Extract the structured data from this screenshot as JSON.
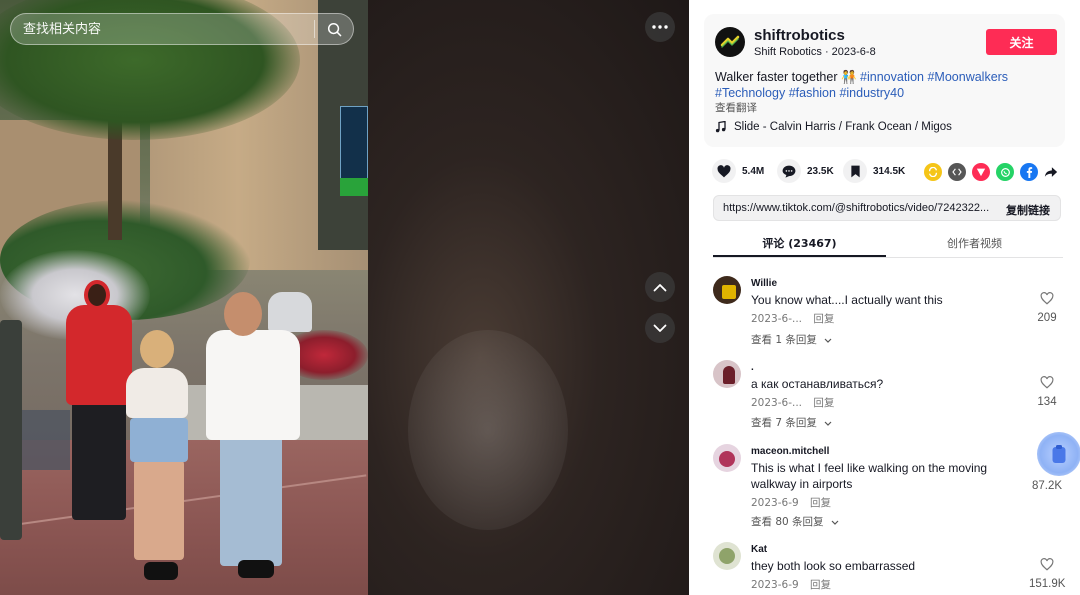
{
  "search": {
    "placeholder": "查找相关内容"
  },
  "video": {
    "more_label": "more",
    "nav_up": "previous",
    "nav_down": "next"
  },
  "author": {
    "name": "shiftrobotics",
    "display": "Shift Robotics",
    "date": "2023-6-8",
    "follow_label": "关注"
  },
  "description": {
    "text": "Walker faster together 🧑‍🤝‍🧑",
    "tags": [
      "#innovation",
      "#Moonwalkers",
      "#Technology",
      "#fashion",
      "#industry40"
    ],
    "translate_label": "查看翻译"
  },
  "music": {
    "title": "Slide - Calvin Harris / Frank Ocean / Migos"
  },
  "stats": {
    "likes": "5.4M",
    "comments": "23.5K",
    "saves": "314.5K"
  },
  "share_icons": [
    "repost-icon",
    "embed-icon",
    "send-icon",
    "whatsapp-icon",
    "facebook-icon",
    "share-arrow-icon"
  ],
  "link": {
    "url": "https://www.tiktok.com/@shiftrobotics/video/7242322...",
    "copy_label": "复制链接"
  },
  "tabs": [
    {
      "label": "评论 (23467)"
    },
    {
      "label": "创作者视频"
    }
  ],
  "comments": [
    {
      "user": "Willie",
      "text": "You know what....I actually want this",
      "date": "2023-6-...",
      "reply": "回复",
      "likes": "209",
      "view_replies": "查看 1 条回复"
    },
    {
      "user": ".",
      "text": "а как останавливаться?",
      "date": "2023-6-...",
      "reply": "回复",
      "likes": "134",
      "view_replies": "查看 7 条回复"
    },
    {
      "user": "maceon.mitchell",
      "text": "This is what I feel like walking on the moving walkway in airports",
      "date": "2023-6-9",
      "reply": "回复",
      "likes": "87.2K",
      "view_replies": "查看 80 条回复"
    },
    {
      "user": "Kat",
      "text": "they both look so embarrassed",
      "date": "2023-6-9",
      "reply": "回复",
      "likes": "151.9K"
    }
  ],
  "colors": {
    "accent": "#fe2c55",
    "tag": "#2b5db9"
  }
}
